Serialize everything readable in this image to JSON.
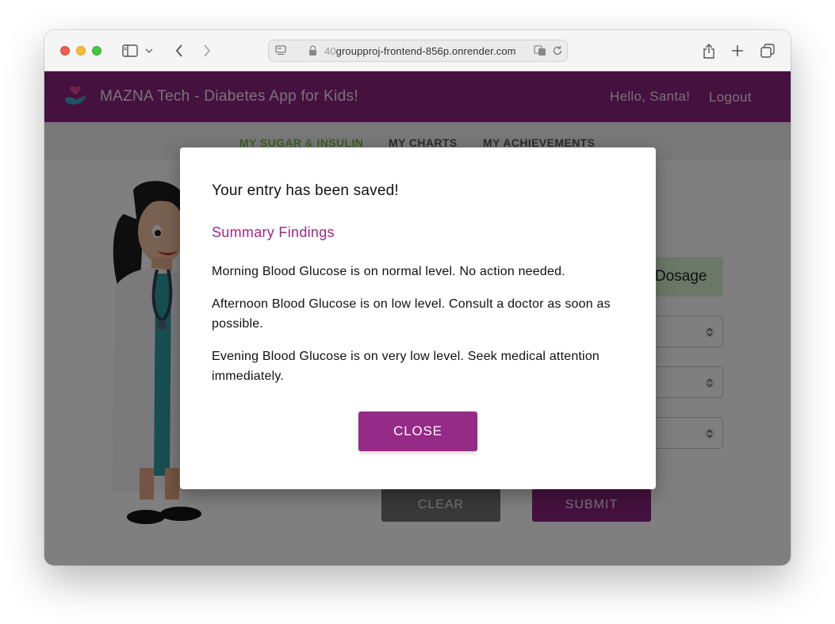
{
  "browser": {
    "url_prefix": "40",
    "url_host": "groupproj-frontend-856p.onrender.com"
  },
  "header": {
    "app_title": "MAZNA Tech - Diabetes App for Kids!",
    "greeting": "Hello, Santa!",
    "logout_label": "Logout"
  },
  "nav": {
    "items": [
      {
        "label": "MY SUGAR & INSULIN",
        "active": true
      },
      {
        "label": "MY CHARTS",
        "active": false
      },
      {
        "label": "MY ACHIEVEMENTS",
        "active": false
      }
    ]
  },
  "form": {
    "dosage_label": "Dosage",
    "clear_label": "CLEAR",
    "submit_label": "SUBMIT"
  },
  "modal": {
    "saved_message": "Your entry has been saved!",
    "heading": "Summary Findings",
    "findings": [
      "Morning Blood Glucose is on normal level. No action needed.",
      "Afternoon Blood Glucose is on low level. Consult a doctor as soon as possible.",
      "Evening Blood Glucose is on very low level. Seek medical attention immediately."
    ],
    "close_label": "CLOSE"
  },
  "colors": {
    "brand": "#8a237e",
    "nav_active": "#7ab648",
    "dosage_bg": "#d9f0cf"
  }
}
